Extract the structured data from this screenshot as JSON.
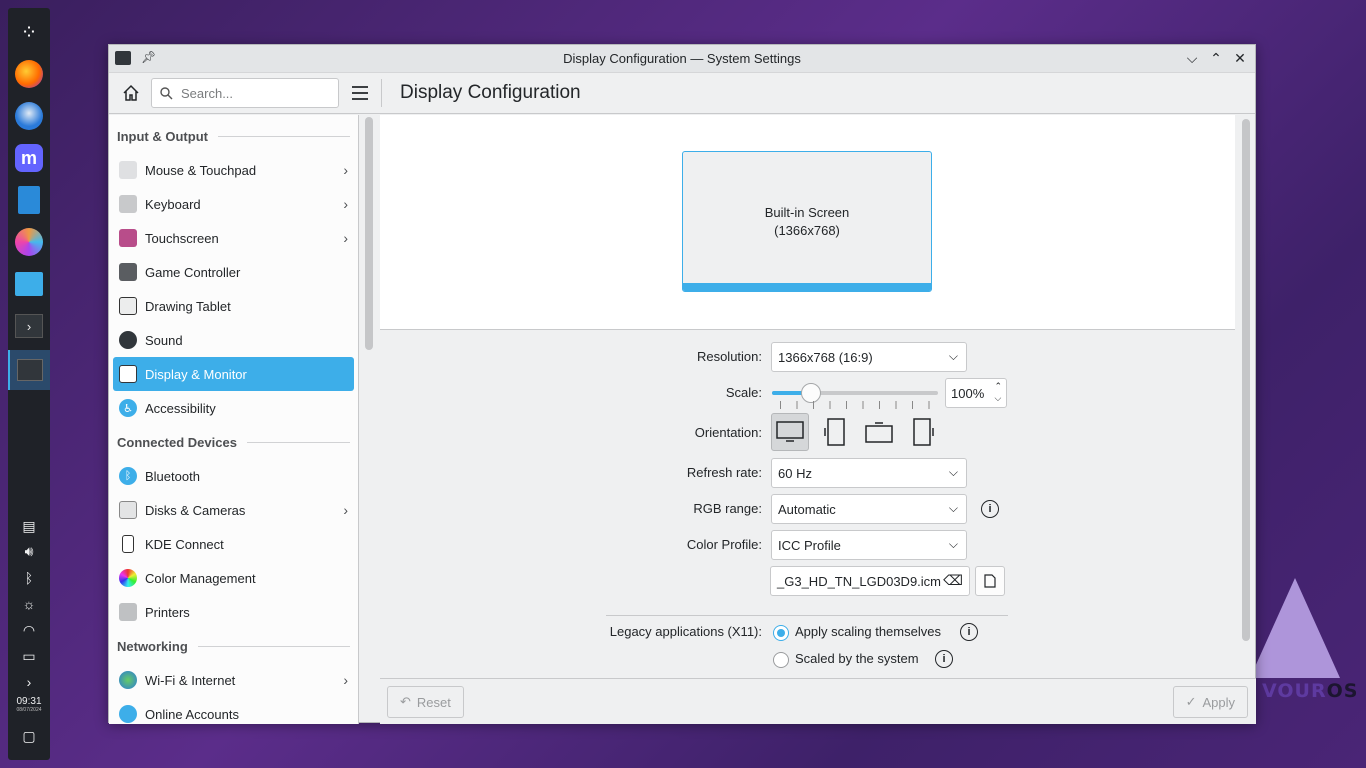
{
  "window": {
    "title": "Display Configuration — System Settings"
  },
  "toolbar": {
    "search_placeholder": "Search...",
    "page_title": "Display Configuration"
  },
  "sidebar": {
    "sections": [
      {
        "title": "Input & Output",
        "items": [
          {
            "label": "Mouse & Touchpad",
            "has_children": true
          },
          {
            "label": "Keyboard",
            "has_children": true
          },
          {
            "label": "Touchscreen",
            "has_children": true
          },
          {
            "label": "Game Controller",
            "has_children": false
          },
          {
            "label": "Drawing Tablet",
            "has_children": false
          },
          {
            "label": "Sound",
            "has_children": false
          },
          {
            "label": "Display & Monitor",
            "has_children": false,
            "selected": true
          },
          {
            "label": "Accessibility",
            "has_children": false
          }
        ]
      },
      {
        "title": "Connected Devices",
        "items": [
          {
            "label": "Bluetooth",
            "has_children": false
          },
          {
            "label": "Disks & Cameras",
            "has_children": true
          },
          {
            "label": "KDE Connect",
            "has_children": false
          },
          {
            "label": "Color Management",
            "has_children": false
          },
          {
            "label": "Printers",
            "has_children": false
          }
        ]
      },
      {
        "title": "Networking",
        "items": [
          {
            "label": "Wi-Fi & Internet",
            "has_children": true
          },
          {
            "label": "Online Accounts",
            "has_children": false
          }
        ]
      }
    ]
  },
  "preview": {
    "screen_name": "Built-in Screen",
    "screen_res": "(1366x768)"
  },
  "form": {
    "resolution_label": "Resolution:",
    "resolution_value": "1366x768 (16:9)",
    "scale_label": "Scale:",
    "scale_value": "100%",
    "scale_fraction": 0.2,
    "orientation_label": "Orientation:",
    "refresh_label": "Refresh rate:",
    "refresh_value": "60 Hz",
    "rgb_label": "RGB range:",
    "rgb_value": "Automatic",
    "color_profile_label": "Color Profile:",
    "color_profile_value": "ICC Profile",
    "icc_file": "_G3_HD_TN_LGD03D9.icm",
    "legacy_label": "Legacy applications (X11):",
    "legacy_opt1": "Apply scaling themselves",
    "legacy_opt2": "Scaled by the system"
  },
  "footer": {
    "reset": "Reset",
    "apply": "Apply"
  },
  "panel": {
    "time": "09:31",
    "date": "08/07/2024"
  },
  "desktop": {
    "brand_a": "VOUR",
    "brand_b": "OS"
  }
}
